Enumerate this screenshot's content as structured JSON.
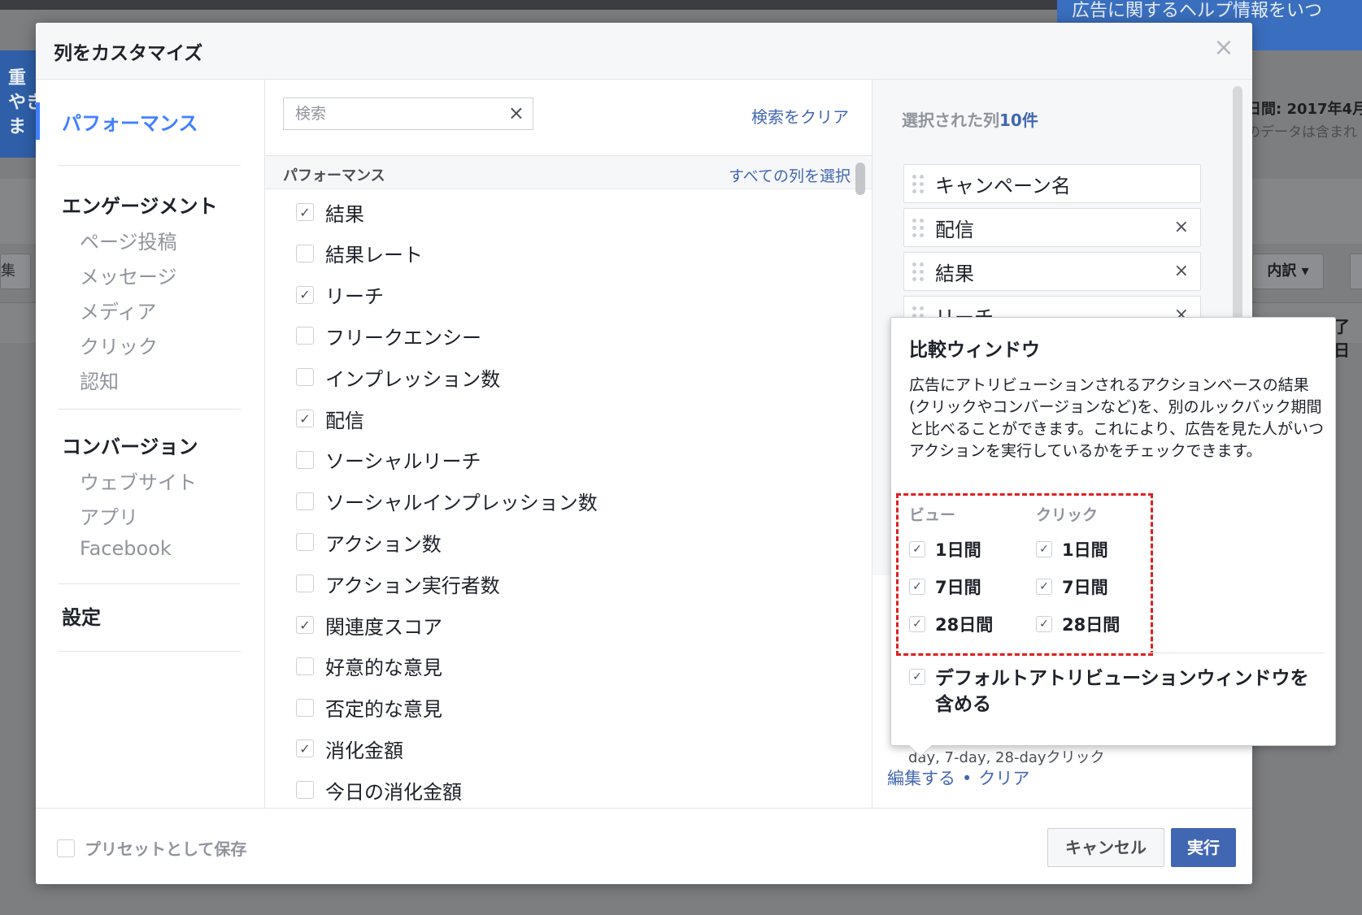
{
  "background": {
    "left_banner": "重\nやきま",
    "right_banner": "広告に関するヘルプ情報をいつ\nックできます",
    "date_range": "日間: 2017年4月",
    "date_sub": "のデータは含まれ",
    "left_button": "集",
    "breakdown_button": "内訳 ▾",
    "end_date": "了日"
  },
  "modal": {
    "title": "列をカスタマイズ",
    "close_icon": "close-icon"
  },
  "nav": {
    "performance": "パフォーマンス",
    "engagement": "エンゲージメント",
    "engagement_items": [
      "ページ投稿",
      "メッセージ",
      "メディア",
      "クリック",
      "認知"
    ],
    "conversion": "コンバージョン",
    "conversion_items": [
      "ウェブサイト",
      "アプリ",
      "Facebook"
    ],
    "settings": "設定"
  },
  "middle": {
    "search_placeholder": "検索",
    "clear_search": "検索をクリア",
    "group_title": "パフォーマンス",
    "select_all": "すべての列を選択",
    "columns": [
      {
        "label": "結果",
        "checked": true
      },
      {
        "label": "結果レート",
        "checked": false
      },
      {
        "label": "リーチ",
        "checked": true
      },
      {
        "label": "フリークエンシー",
        "checked": false
      },
      {
        "label": "インプレッション数",
        "checked": false
      },
      {
        "label": "配信",
        "checked": true
      },
      {
        "label": "ソーシャルリーチ",
        "checked": false
      },
      {
        "label": "ソーシャルインプレッション数",
        "checked": false
      },
      {
        "label": "アクション数",
        "checked": false
      },
      {
        "label": "アクション実行者数",
        "checked": false
      },
      {
        "label": "関連度スコア",
        "checked": true
      },
      {
        "label": "好意的な意見",
        "checked": false
      },
      {
        "label": "否定的な意見",
        "checked": false
      },
      {
        "label": "消化金額",
        "checked": true
      },
      {
        "label": "今日の消化金額",
        "checked": false
      }
    ]
  },
  "right": {
    "selected_prefix": "選択された列",
    "selected_count": "10件",
    "selected": [
      {
        "label": "キャンペーン名",
        "removable": false
      },
      {
        "label": "配信",
        "removable": true
      },
      {
        "label": "結果",
        "removable": true
      },
      {
        "label": "リーチ",
        "removable": true
      }
    ],
    "attribution_partial": "day, 7-day, 28-dayクリック",
    "edit": "編集する",
    "clear": "クリア"
  },
  "popover": {
    "title": "比較ウィンドウ",
    "description": "広告にアトリビューションされるアクションベースの結果(クリックやコンバージョンなど)を、別のルックバック期間と比べることができます。これにより、広告を見た人がいつアクションを実行しているかをチェックできます。",
    "view_header": "ビュー",
    "click_header": "クリック",
    "windows": [
      "1日間",
      "7日間",
      "28日間"
    ],
    "default_attribution": "デフォルトアトリビューションウィンドウを含める"
  },
  "footer": {
    "save_preset": "プリセットとして保存",
    "cancel": "キャンセル",
    "run": "実行"
  },
  "colors": {
    "accent_blue": "#4267b2",
    "active_nav": "#4080ff",
    "highlight_red": "#e02020"
  }
}
